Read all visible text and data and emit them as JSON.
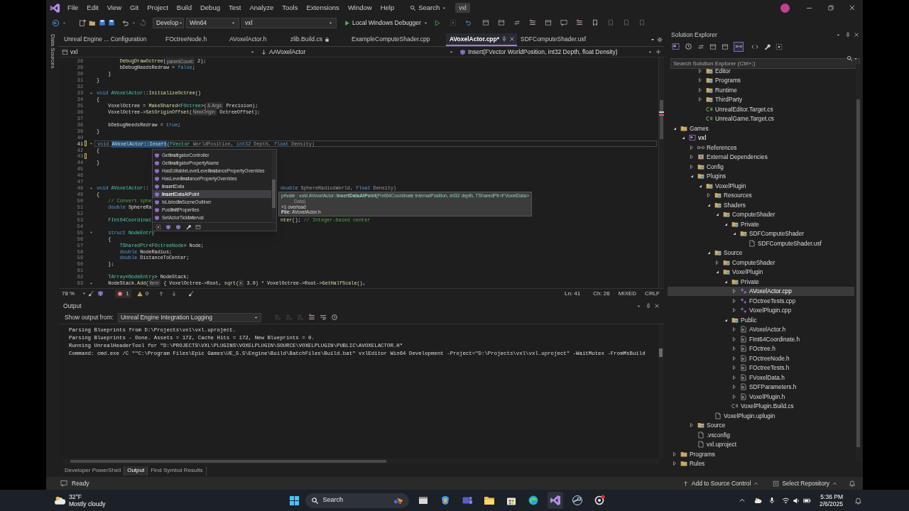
{
  "title_bar": {
    "menus": [
      "File",
      "Edit",
      "View",
      "Git",
      "Project",
      "Build",
      "Debug",
      "Test",
      "Analyze",
      "Tools",
      "Extensions",
      "Window",
      "Help"
    ],
    "search": "Search",
    "solution_badge": "vxl"
  },
  "toolbar": {
    "configuration": "Develop",
    "platform": "Win64",
    "startup_project": "vxl",
    "debugger": "Local Windows Debugger"
  },
  "side_tab": "Data Sources",
  "editor": {
    "tabs": [
      {
        "label": "Unreal Engine ... Configuration",
        "selected": false,
        "locked": false
      },
      {
        "label": "FOctreeNode.h",
        "selected": false,
        "locked": false
      },
      {
        "label": "AVoxelActor.h",
        "selected": false,
        "locked": false
      },
      {
        "label": "zlib.Build.cs",
        "selected": false,
        "locked": true
      },
      {
        "label": "ExampleComputeShader.cpp",
        "selected": false,
        "locked": false
      },
      {
        "label": "AVoxelActor.cpp*",
        "selected": true,
        "locked": false
      },
      {
        "label": "SDFComputeShader.usf",
        "selected": false,
        "locked": false
      }
    ],
    "nav": {
      "project": "vxl",
      "scope": "AAVoxelActor",
      "member": "Insert(FVector WorldPosition, int32 Depth, float Density)"
    },
    "lines": [
      {
        "number": "28",
        "current": false,
        "changed": false,
        "foldable": false,
        "segments": [
          {
            "kind": "function",
            "text": "        DebugDrawOctree"
          },
          {
            "kind": "plain",
            "text": "("
          },
          {
            "kind": "hint",
            "text": "parentCount:"
          },
          {
            "kind": "plain",
            "text": " 2);"
          }
        ]
      },
      {
        "number": "29",
        "current": false,
        "changed": false,
        "foldable": false,
        "segments": [
          {
            "kind": "plain",
            "text": "        bDebugNeedsRedraw = "
          },
          {
            "kind": "keyword",
            "text": "false"
          },
          {
            "kind": "plain",
            "text": ";"
          }
        ]
      },
      {
        "number": "30",
        "current": false,
        "changed": false,
        "foldable": false,
        "segments": [
          {
            "kind": "plain",
            "text": "    }"
          }
        ]
      },
      {
        "number": "31",
        "current": false,
        "changed": false,
        "foldable": false,
        "segments": [
          {
            "kind": "plain",
            "text": "}"
          }
        ]
      },
      {
        "number": "32",
        "current": false,
        "changed": false,
        "foldable": false
      },
      {
        "number": "33",
        "current": false,
        "changed": false,
        "foldable": true,
        "segments": [
          {
            "kind": "keyword",
            "text": "void "
          },
          {
            "kind": "type",
            "text": "AVoxelActor"
          },
          {
            "kind": "plain",
            "text": "::"
          },
          {
            "kind": "function",
            "text": "InitializeOctree"
          },
          {
            "kind": "plain",
            "text": "()"
          }
        ]
      },
      {
        "number": "34",
        "current": false,
        "changed": false,
        "foldable": false,
        "segments": [
          {
            "kind": "plain",
            "text": "{"
          }
        ]
      },
      {
        "number": "35",
        "current": false,
        "changed": false,
        "foldable": false,
        "segments": [
          {
            "kind": "plain",
            "text": "    VoxelOctree = "
          },
          {
            "kind": "function",
            "text": "MakeShared"
          },
          {
            "kind": "plain",
            "text": "<"
          },
          {
            "kind": "type",
            "text": "FOctree"
          },
          {
            "kind": "plain",
            "text": ">("
          },
          {
            "kind": "hint",
            "text": "& Args:"
          },
          {
            "kind": "plain",
            "text": " Precision);"
          }
        ]
      },
      {
        "number": "36",
        "current": false,
        "changed": false,
        "foldable": false,
        "segments": [
          {
            "kind": "plain",
            "text": "    VoxelOctree->"
          },
          {
            "kind": "function",
            "text": "SetOriginOffset"
          },
          {
            "kind": "plain",
            "text": "("
          },
          {
            "kind": "hint",
            "text": "NewOrigin:"
          },
          {
            "kind": "plain",
            "text": " OctreeOffset);"
          }
        ]
      },
      {
        "number": "37",
        "current": false,
        "changed": false,
        "foldable": false
      },
      {
        "number": "38",
        "current": false,
        "changed": false,
        "foldable": false,
        "segments": [
          {
            "kind": "plain",
            "text": "    bDebugNeedsRedraw = "
          },
          {
            "kind": "keyword",
            "text": "true"
          },
          {
            "kind": "plain",
            "text": ";"
          }
        ]
      },
      {
        "number": "39",
        "current": false,
        "changed": false,
        "foldable": false,
        "segments": [
          {
            "kind": "plain",
            "text": "}"
          }
        ]
      },
      {
        "number": "40",
        "current": false,
        "changed": false,
        "foldable": false
      },
      {
        "number": "41",
        "current": true,
        "changed": true,
        "foldable": true,
        "segments": [
          {
            "kind": "keyword",
            "text": "void "
          },
          {
            "kind": "reference",
            "text": "AVoxelActor::Insert"
          },
          {
            "kind": "plain",
            "text": "("
          },
          {
            "kind": "type",
            "text": "FVector"
          },
          {
            "kind": "param",
            "text": " WorldPosition, "
          },
          {
            "kind": "keyword",
            "text": "int32"
          },
          {
            "kind": "param",
            "text": " Depth, "
          },
          {
            "kind": "keyword",
            "text": "float"
          },
          {
            "kind": "param",
            "text": " Density)"
          }
        ]
      },
      {
        "number": "42",
        "current": false,
        "changed": false,
        "foldable": false,
        "segments": [
          {
            "kind": "plain",
            "text": "{"
          }
        ]
      },
      {
        "number": "43",
        "current": false,
        "changed": true,
        "foldable": false
      },
      {
        "number": "44",
        "current": false,
        "changed": false,
        "foldable": false,
        "segments": [
          {
            "kind": "plain",
            "text": "}"
          }
        ]
      },
      {
        "number": "45",
        "current": false,
        "changed": false,
        "foldable": false
      },
      {
        "number": "46",
        "current": false,
        "changed": false,
        "foldable": false
      },
      {
        "number": "47",
        "current": false,
        "changed": false,
        "foldable": false
      },
      {
        "number": "48",
        "current": false,
        "changed": false,
        "foldable": true,
        "segments": [
          {
            "kind": "keyword",
            "text": "void "
          },
          {
            "kind": "type",
            "text": "AVoxelActor"
          },
          {
            "kind": "plain",
            "text": "::"
          }
        ],
        "tail": [
          {
            "kind": "keyword",
            "text": "double"
          },
          {
            "kind": "param",
            "text": " SphereRadiusWorld, "
          },
          {
            "kind": "keyword",
            "text": "float"
          },
          {
            "kind": "param",
            "text": " Density)"
          }
        ]
      },
      {
        "number": "49",
        "current": false,
        "changed": false,
        "foldable": false,
        "segments": [
          {
            "kind": "plain",
            "text": "{"
          }
        ]
      },
      {
        "number": "50",
        "current": false,
        "changed": false,
        "foldable": false,
        "segments": [
          {
            "kind": "comment",
            "text": "    // Convert sphe"
          }
        ]
      },
      {
        "number": "51",
        "current": false,
        "changed": false,
        "foldable": false,
        "segments": [
          {
            "kind": "keyword",
            "text": "    double"
          },
          {
            "kind": "plain",
            "text": " SphereRa"
          }
        ]
      },
      {
        "number": "52",
        "current": false,
        "changed": false,
        "foldable": false
      },
      {
        "number": "53",
        "current": false,
        "changed": false,
        "foldable": false,
        "segments": [
          {
            "kind": "type",
            "text": "    FInt64Coordinat"
          }
        ],
        "tail": [
          {
            "kind": "function",
            "text": "nter"
          },
          {
            "kind": "plain",
            "text": "(); "
          },
          {
            "kind": "comment",
            "text": "// Integer-based center"
          }
        ]
      },
      {
        "number": "54",
        "current": false,
        "changed": false,
        "foldable": false
      },
      {
        "number": "55",
        "current": false,
        "changed": false,
        "foldable": true,
        "segments": [
          {
            "kind": "keyword",
            "text": "    struct "
          },
          {
            "kind": "type",
            "text": "NodeEntry"
          }
        ]
      },
      {
        "number": "56",
        "current": false,
        "changed": false,
        "foldable": false,
        "segments": [
          {
            "kind": "plain",
            "text": "    {"
          }
        ]
      },
      {
        "number": "57",
        "current": false,
        "changed": false,
        "foldable": false,
        "segments": [
          {
            "kind": "type",
            "text": "        TSharedPtr"
          },
          {
            "kind": "plain",
            "text": "<"
          },
          {
            "kind": "type",
            "text": "FOctreeNode"
          },
          {
            "kind": "plain",
            "text": "> Node;"
          }
        ]
      },
      {
        "number": "58",
        "current": false,
        "changed": false,
        "foldable": false,
        "segments": [
          {
            "kind": "keyword",
            "text": "        double"
          },
          {
            "kind": "plain",
            "text": " NodeRadius;"
          }
        ]
      },
      {
        "number": "59",
        "current": false,
        "changed": false,
        "foldable": false,
        "segments": [
          {
            "kind": "keyword",
            "text": "        double"
          },
          {
            "kind": "plain",
            "text": " DistanceToCenter;"
          }
        ]
      },
      {
        "number": "60",
        "current": false,
        "changed": false,
        "foldable": false,
        "segments": [
          {
            "kind": "plain",
            "text": "    };"
          }
        ]
      },
      {
        "number": "61",
        "current": false,
        "changed": false,
        "foldable": false
      },
      {
        "number": "62",
        "current": false,
        "changed": false,
        "foldable": false,
        "segments": [
          {
            "kind": "type",
            "text": "    TArray"
          },
          {
            "kind": "plain",
            "text": "<"
          },
          {
            "kind": "type",
            "text": "NodeEntry"
          },
          {
            "kind": "plain",
            "text": "> NodeStack;"
          }
        ]
      },
      {
        "number": "63",
        "current": false,
        "changed": false,
        "foldable": true,
        "segments": [
          {
            "kind": "plain",
            "text": "    NodeStack."
          },
          {
            "kind": "function",
            "text": "Add"
          },
          {
            "kind": "plain",
            "text": "("
          },
          {
            "kind": "hint",
            "text": "Item:"
          },
          {
            "kind": "plain",
            "text": " { VoxelOctree->Root, "
          },
          {
            "kind": "function",
            "text": "sqrt"
          },
          {
            "kind": "plain",
            "text": "("
          },
          {
            "kind": "hint",
            "text": "x:"
          },
          {
            "kind": "plain",
            "text": " 3.0) * VoxelOctree->Root->"
          },
          {
            "kind": "function",
            "text": "GetHalfScale"
          },
          {
            "kind": "plain",
            "text": "(),"
          }
        ]
      }
    ],
    "autocomplete": [
      {
        "label": "Get**Inst**igatorController",
        "selected": false
      },
      {
        "label": "Get**Inst**igatorPropertyName",
        "selected": false
      },
      {
        "label": "HasEditableLevelLevel**Inst**ancePropertyOverrides",
        "selected": false
      },
      {
        "label": "HasLevel**Inst**ancePropertyOverrides",
        "selected": false
      },
      {
        "label": "**Insert**Data",
        "selected": false
      },
      {
        "label": "**Insert**DataAtPoint",
        "selected": true
      },
      {
        "label": "IsListed**In**SceneOutliner",
        "selected": false
      },
      {
        "label": "Post**Init**Properties",
        "selected": false
      },
      {
        "label": "SetActorTick**Int**erval",
        "selected": false
      }
    ],
    "quick_info": {
      "signature": "private : void AVoxelActor::**InsertDataAtPoint**(FInt64Coordinate internalPosition, int32 depth, TSharedPtr<FVoxelData>",
      "signature_continued": "Data)",
      "overload": "+1 overload",
      "file": "**File:** AVoxelActor.h"
    },
    "status": {
      "zoom": "78 %",
      "errors": "1",
      "warnings": "0",
      "line": "Ln: 41",
      "column": "Ch: 26",
      "whitespace": "MIXED",
      "line_endings": "CRLF"
    }
  },
  "output": {
    "title": "Output",
    "source_label": "Show output from:",
    "source": "Unreal Engine Integration Logging",
    "lines": [
      "Parsing Blueprints from D:\\Projects\\vxl\\vxl.uproject.",
      "Parsing Blueprints - Done. Assets = 172, Cache Hits = 172, New Blueprints = 0.",
      "Running UnrealHeaderTool for \"D:\\PROJECTS\\VXL\\PLUGINS\\VOXELPLUGIN\\SOURCE\\VOXELPLUGIN\\PUBLIC\\AVOXELACTOR.H\"",
      "Command: cmd.exe /C \"\"C:\\Program Files\\Epic Games\\UE_5.5\\Engine\\Build\\BatchFiles\\Build.bat\" vxlEditor Win64 Development -Project=\"D:\\Projects\\vxl\\vxl.uproject\" -WaitMutex -FromMsBuild"
    ],
    "tabs": [
      {
        "label": "Developer PowerShell",
        "selected": false
      },
      {
        "label": "Output",
        "selected": true
      },
      {
        "label": "Find Symbol Results",
        "selected": false
      }
    ]
  },
  "solution_explorer": {
    "title": "Solution Explorer",
    "search_placeholder": "Search Solution Explorer (Ctrl+;)",
    "scrolled_items": [
      {
        "label": "Editor",
        "kind": "filter",
        "expanded": false,
        "selected": false
      },
      {
        "label": "Programs",
        "kind": "filter",
        "expanded": false,
        "selected": false
      },
      {
        "label": "Runtime",
        "kind": "filter",
        "expanded": false,
        "selected": false
      },
      {
        "label": "ThirdParty",
        "kind": "filter",
        "expanded": false,
        "selected": false
      },
      {
        "label": "UnrealEditor.Target.cs",
        "kind": "csharp",
        "selected": false
      },
      {
        "label": "UnrealGame.Target.cs",
        "kind": "csharp",
        "selected": false
      }
    ],
    "tree": [
      {
        "label": "Games",
        "kind": "folder",
        "expanded": true,
        "selected": false,
        "children": [
          {
            "label": "vxl",
            "kind": "project",
            "expanded": true,
            "selected": false,
            "children": [
              {
                "label": "References",
                "kind": "references",
                "expanded": false,
                "selected": false
              },
              {
                "label": "External Dependencies",
                "kind": "dependencies",
                "expanded": false,
                "selected": false
              },
              {
                "label": "Config",
                "kind": "filter",
                "expanded": false,
                "selected": false
              },
              {
                "label": "Plugins",
                "kind": "filter",
                "expanded": true,
                "selected": false,
                "children": [
                  {
                    "label": "VoxelPlugin",
                    "kind": "filter",
                    "expanded": true,
                    "selected": false,
                    "children": [
                      {
                        "label": "Resources",
                        "kind": "filter",
                        "expanded": false,
                        "selected": false
                      },
                      {
                        "label": "Shaders",
                        "kind": "filter",
                        "expanded": true,
                        "selected": false,
                        "children": [
                          {
                            "label": "ComputeShader",
                            "kind": "filter",
                            "expanded": true,
                            "selected": false,
                            "children": [
                              {
                                "label": "Private",
                                "kind": "filter",
                                "expanded": true,
                                "selected": false,
                                "children": [
                                  {
                                    "label": "SDFComputeShader",
                                    "kind": "filter",
                                    "expanded": true,
                                    "selected": false,
                                    "children": [
                                      {
                                        "label": "SDFComputeShader.usf",
                                        "kind": "file",
                                        "selected": false
                                      }
                                    ]
                                  }
                                ]
                              }
                            ]
                          }
                        ]
                      },
                      {
                        "label": "Source",
                        "kind": "filter",
                        "expanded": true,
                        "selected": false,
                        "children": [
                          {
                            "label": "ComputeShader",
                            "kind": "filter",
                            "expanded": false,
                            "selected": false
                          },
                          {
                            "label": "VoxelPlugin",
                            "kind": "filter",
                            "expanded": true,
                            "selected": false,
                            "children": [
                              {
                                "label": "Private",
                                "kind": "filter",
                                "expanded": true,
                                "selected": false,
                                "children": [
                                  {
                                    "label": "AVoxelActor.cpp",
                                    "kind": "cpp",
                                    "expanded": false,
                                    "selected": true
                                  },
                                  {
                                    "label": "FOctreeTests.cpp",
                                    "kind": "cpp",
                                    "expanded": false,
                                    "selected": false
                                  },
                                  {
                                    "label": "VoxelPlugin.cpp",
                                    "kind": "cpp",
                                    "expanded": false,
                                    "selected": false
                                  }
                                ]
                              },
                              {
                                "label": "Public",
                                "kind": "filter",
                                "expanded": true,
                                "selected": false,
                                "children": [
                                  {
                                    "label": "AVoxelActor.h",
                                    "kind": "header",
                                    "expanded": false,
                                    "selected": false
                                  },
                                  {
                                    "label": "FInt64Coordinate.h",
                                    "kind": "header",
                                    "expanded": false,
                                    "selected": false
                                  },
                                  {
                                    "label": "FOctree.h",
                                    "kind": "header",
                                    "expanded": false,
                                    "selected": false
                                  },
                                  {
                                    "label": "FOctreeNode.h",
                                    "kind": "header",
                                    "expanded": false,
                                    "selected": false
                                  },
                                  {
                                    "label": "FOctreeTests.h",
                                    "kind": "header",
                                    "expanded": false,
                                    "selected": false
                                  },
                                  {
                                    "label": "FVoxelData.h",
                                    "kind": "header",
                                    "expanded": false,
                                    "selected": false
                                  },
                                  {
                                    "label": "SDFParameters.h",
                                    "kind": "header",
                                    "expanded": false,
                                    "selected": false
                                  },
                                  {
                                    "label": "VoxelPlugin.h",
                                    "kind": "header",
                                    "expanded": false,
                                    "selected": false
                                  }
                                ]
                              },
                              {
                                "label": "VoxelPlugin.Build.cs",
                                "kind": "csharp",
                                "selected": false
                              }
                            ]
                          }
                        ]
                      },
                      {
                        "label": "VoxelPlugin.uplugin",
                        "kind": "file",
                        "selected": false
                      }
                    ]
                  }
                ]
              },
              {
                "label": "Source",
                "kind": "filter",
                "expanded": false,
                "selected": false
              },
              {
                "label": ".vsconfig",
                "kind": "file",
                "selected": false
              },
              {
                "label": "vxl.uproject",
                "kind": "file",
                "selected": false
              }
            ]
          }
        ]
      },
      {
        "label": "Programs",
        "kind": "folder",
        "expanded": false,
        "selected": false
      },
      {
        "label": "Rules",
        "kind": "folder",
        "expanded": false,
        "selected": false
      }
    ]
  },
  "status_bar": {
    "text": "Ready",
    "source_control": "Add to Source Control",
    "repository": "Select Repository"
  },
  "taskbar": {
    "temperature": "32°F",
    "weather": "Mostly cloudy",
    "search": "Search",
    "time": "5:36 PM",
    "date": "2/6/2025"
  }
}
